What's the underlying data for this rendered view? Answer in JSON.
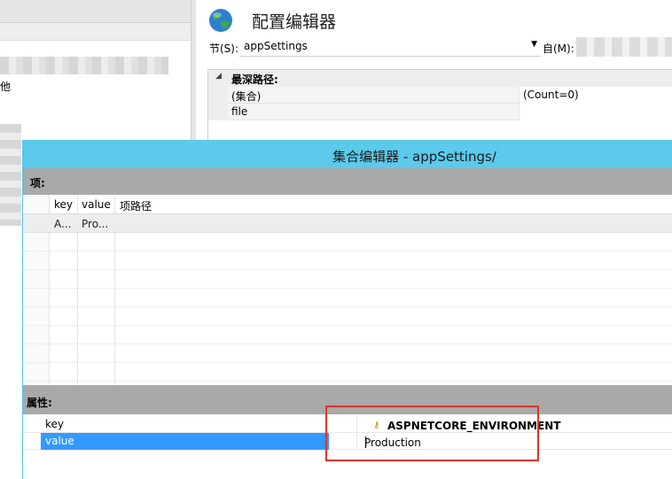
{
  "background": {
    "left_partial_text": "他",
    "page_title": "配置编辑器",
    "section_label": "节(S):",
    "section_value": "appSettings",
    "from_label": "自(M):",
    "property_grid": {
      "header": "最深路径:",
      "rows": [
        {
          "name": "(集合)",
          "value": "(Count=0)"
        },
        {
          "name": "file",
          "value": ""
        }
      ]
    }
  },
  "dialog": {
    "title": "集合编辑器 - appSettings/",
    "items_label": "项:",
    "items_columns": [
      "key",
      "value",
      "项路径"
    ],
    "items_rows": [
      {
        "key": "A...",
        "value": "Pro..."
      }
    ],
    "props_label": "属性:",
    "props": [
      {
        "name": "key",
        "value": "ASPNETCORE_ENVIRONMENT"
      },
      {
        "name": "value",
        "value": "Production"
      }
    ]
  },
  "colors": {
    "dialog_titlebar": "#5bcaeb",
    "section_header": "#a9a9a9",
    "selection": "#3399ff",
    "highlight": "#e0342b"
  },
  "icons": [
    "globe-icon",
    "dropdown-arrow-icon",
    "expander-icon",
    "key-icon"
  ]
}
